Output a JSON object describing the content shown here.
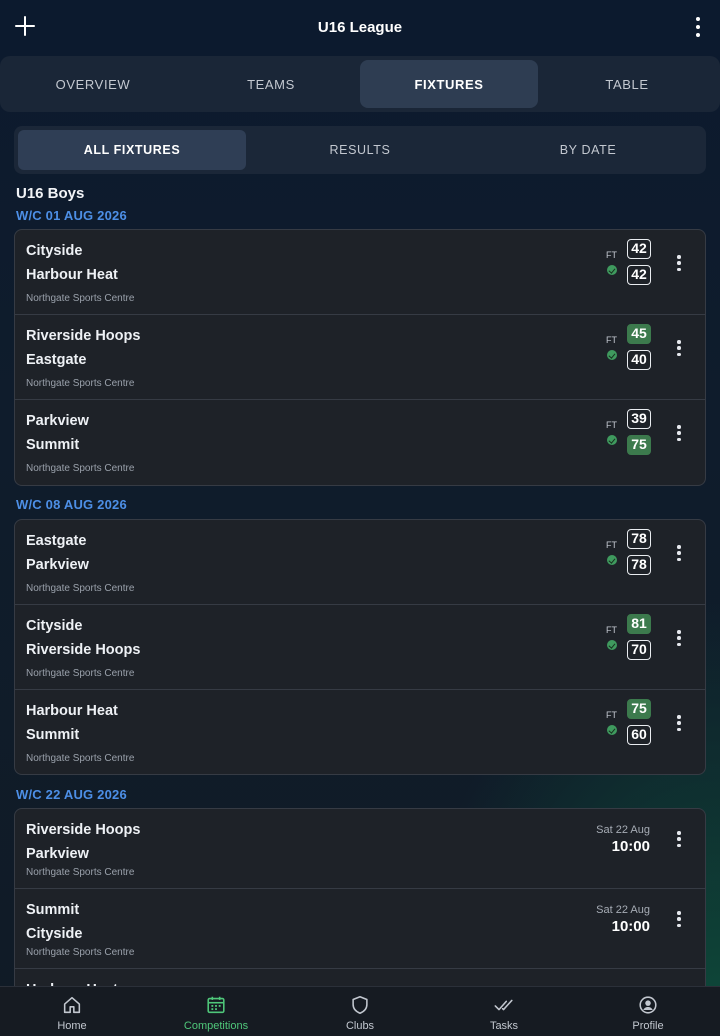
{
  "header": {
    "title": "U16 League",
    "add_icon": "plus-icon",
    "menu_icon": "more-vertical-icon"
  },
  "tabs": [
    "OVERVIEW",
    "TEAMS",
    "FIXTURES",
    "TABLE"
  ],
  "active_tab": "FIXTURES",
  "subtabs": [
    "ALL FIXTURES",
    "RESULTS",
    "BY DATE"
  ],
  "active_subtab": "ALL FIXTURES",
  "group_title": "U16 Boys",
  "colors": {
    "accent_blue": "#4d8fe6",
    "win_green": "#3c7a4d",
    "active_nav": "#4fc77a"
  },
  "weeks": [
    {
      "label": "W/C 01 AUG 2026",
      "fixtures": [
        {
          "home": "Cityside",
          "away": "Harbour Heat",
          "venue": "Northgate Sports Centre",
          "status": "FT",
          "home_score": "42",
          "away_score": "42",
          "winner": "none"
        },
        {
          "home": "Riverside Hoops",
          "away": "Eastgate",
          "venue": "Northgate Sports Centre",
          "status": "FT",
          "home_score": "45",
          "away_score": "40",
          "winner": "home"
        },
        {
          "home": "Parkview",
          "away": "Summit",
          "venue": "Northgate Sports Centre",
          "status": "FT",
          "home_score": "39",
          "away_score": "75",
          "winner": "away"
        }
      ]
    },
    {
      "label": "W/C 08 AUG 2026",
      "fixtures": [
        {
          "home": "Eastgate",
          "away": "Parkview",
          "venue": "Northgate Sports Centre",
          "status": "FT",
          "home_score": "78",
          "away_score": "78",
          "winner": "none"
        },
        {
          "home": "Cityside",
          "away": "Riverside Hoops",
          "venue": "Northgate Sports Centre",
          "status": "FT",
          "home_score": "81",
          "away_score": "70",
          "winner": "home"
        },
        {
          "home": "Harbour Heat",
          "away": "Summit",
          "venue": "Northgate Sports Centre",
          "status": "FT",
          "home_score": "75",
          "away_score": "60",
          "winner": "home"
        }
      ]
    },
    {
      "label": "W/C 22 AUG 2026",
      "fixtures": [
        {
          "home": "Riverside Hoops",
          "away": "Parkview",
          "venue": "Northgate Sports Centre",
          "date": "Sat 22 Aug",
          "time": "10:00"
        },
        {
          "home": "Summit",
          "away": "Cityside",
          "venue": "Northgate Sports Centre",
          "date": "Sat 22 Aug",
          "time": "10:00"
        },
        {
          "home": "Harbour Heat",
          "away": "",
          "venue": "",
          "date": "",
          "time": ""
        }
      ]
    }
  ],
  "bottom_nav": [
    {
      "label": "Home",
      "icon": "home-icon",
      "active": false
    },
    {
      "label": "Competitions",
      "icon": "calendar-icon",
      "active": true
    },
    {
      "label": "Clubs",
      "icon": "shield-icon",
      "active": false
    },
    {
      "label": "Tasks",
      "icon": "double-check-icon",
      "active": false
    },
    {
      "label": "Profile",
      "icon": "user-circle-icon",
      "active": false
    }
  ]
}
